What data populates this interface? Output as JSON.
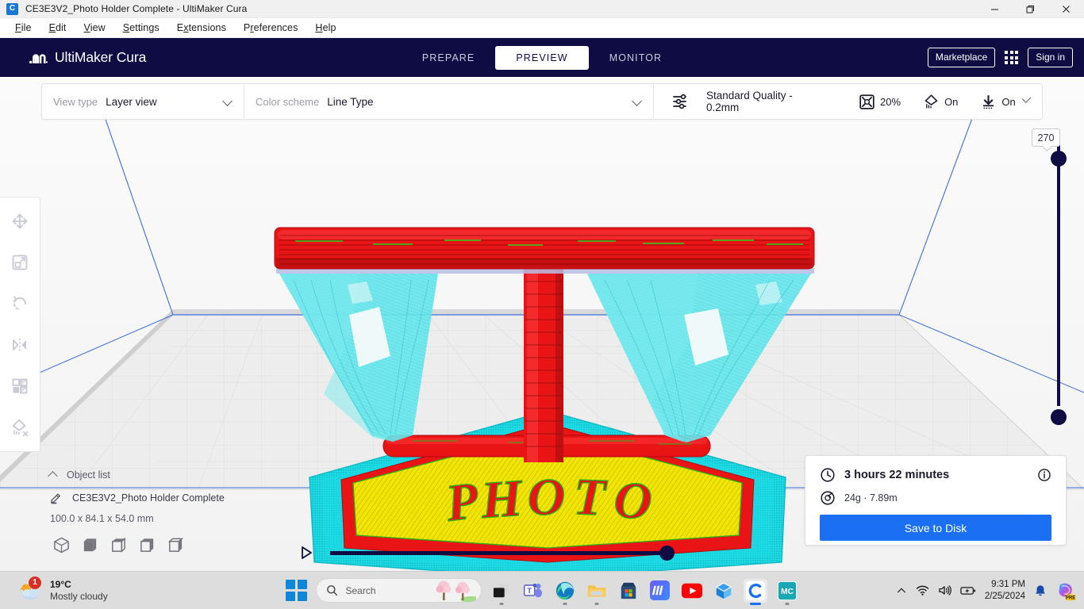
{
  "window": {
    "title": "CE3E3V2_Photo Holder Complete - UltiMaker Cura",
    "app_icon": "C",
    "minimize_label": "—",
    "maximize_label": "❐",
    "close_label": "✕"
  },
  "menubar": {
    "items": [
      {
        "label": "File",
        "accel": "F"
      },
      {
        "label": "Edit",
        "accel": "E"
      },
      {
        "label": "View",
        "accel": "V"
      },
      {
        "label": "Settings",
        "accel": "S"
      },
      {
        "label": "Extensions",
        "accel": "x"
      },
      {
        "label": "Preferences",
        "accel": "r"
      },
      {
        "label": "Help",
        "accel": "H"
      }
    ]
  },
  "header": {
    "brand": "UltiMaker Cura",
    "brand_color": "#0e0c43",
    "tabs": [
      {
        "label": "PREPARE",
        "active": false
      },
      {
        "label": "PREVIEW",
        "active": true
      },
      {
        "label": "MONITOR",
        "active": false
      }
    ],
    "marketplace_label": "Marketplace",
    "signin_label": "Sign in",
    "apps_icon": "grid-apps-icon"
  },
  "settings_bar": {
    "view_type_label": "View type",
    "view_type_value": "Layer view",
    "color_scheme_label": "Color scheme",
    "color_scheme_value": "Line Type",
    "profile_value": "Standard Quality - 0.2mm",
    "infill_value": "20%",
    "support_value": "On",
    "adhesion_value": "On"
  },
  "toolbar": {
    "tools": [
      {
        "name": "move-tool",
        "title": "Move"
      },
      {
        "name": "scale-tool",
        "title": "Scale"
      },
      {
        "name": "rotate-tool",
        "title": "Rotate"
      },
      {
        "name": "mirror-tool",
        "title": "Mirror"
      },
      {
        "name": "per-model-settings-tool",
        "title": "Per Model Settings"
      },
      {
        "name": "support-blocker-tool",
        "title": "Support Blocker"
      }
    ]
  },
  "object_list": {
    "title": "Object list",
    "object_name": "CE3E3V2_Photo Holder Complete",
    "dimensions": "100.0 x 84.1 x 54.0 mm",
    "view_buttons": [
      "3d-view",
      "front-view",
      "top-view",
      "left-view",
      "right-view"
    ]
  },
  "print_info": {
    "time": "3 hours 22 minutes",
    "material": "24g · 7.89m",
    "save_label": "Save to Disk",
    "save_color": "#1b6ff3",
    "info_icon": "info-icon",
    "clock_icon": "clock-icon",
    "spool_icon": "spool-icon"
  },
  "layer_slider": {
    "value": "270",
    "orientation": "vertical"
  },
  "sim_slider": {
    "play_label": "play-icon",
    "position_pct": 100
  },
  "taskbar": {
    "weather_temp": "19°C",
    "weather_cond": "Mostly cloudy",
    "weather_badge": "1",
    "search_placeholder": "Search",
    "apps": [
      {
        "name": "task-view-icon"
      },
      {
        "name": "microsoft-teams-icon"
      },
      {
        "name": "microsoft-edge-icon"
      },
      {
        "name": "file-explorer-icon"
      },
      {
        "name": "microsoft-store-icon"
      },
      {
        "name": "makerworld-icon"
      },
      {
        "name": "youtube-icon"
      },
      {
        "name": "3d-builder-icon"
      },
      {
        "name": "ultimaker-cura-icon"
      },
      {
        "name": "mc-app-icon"
      }
    ],
    "tray": {
      "chevron": "show-hidden-icons",
      "wifi": "wifi-icon",
      "volume": "volume-icon",
      "battery": "battery-charging-icon",
      "time": "9:31 PM",
      "date": "2/25/2024",
      "bell": "notifications-icon",
      "copilot": "copilot-icon",
      "copilot_badge": "PRE"
    }
  },
  "scene": {
    "model_text": "PHOTO",
    "colors": {
      "wall": "#e81416",
      "infill": "#f2e500",
      "support": "#5ee3e8",
      "skirt": "#16e0e8",
      "travel": "#3cd93c",
      "buildplate": "#ededed"
    }
  }
}
